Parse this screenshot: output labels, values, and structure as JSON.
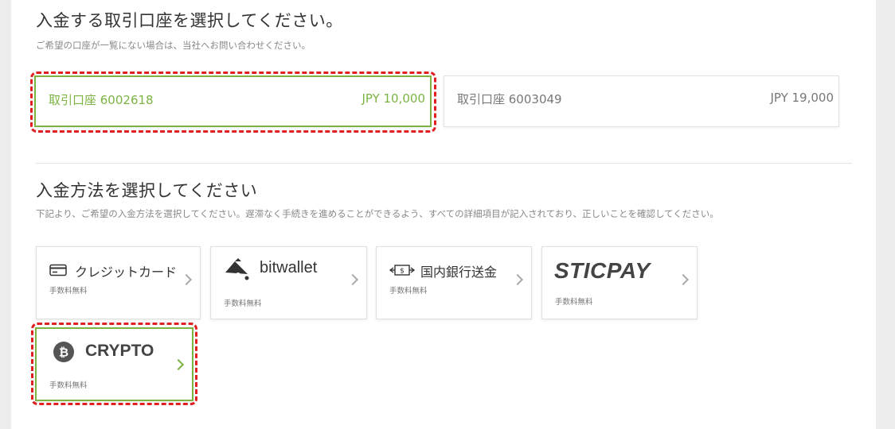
{
  "account_section": {
    "title": "入金する取引口座を選択してください。",
    "subtitle": "ご希望の口座が一覧にない場合は、当社へお問い合わせください。",
    "accounts": [
      {
        "name": "取引口座 6002618",
        "balance": "JPY 10,000",
        "selected": true
      },
      {
        "name": "取引口座 6003049",
        "balance": "JPY 19,000",
        "selected": false
      }
    ]
  },
  "method_section": {
    "title": "入金方法を選択してください",
    "subtitle": "下記より、ご希望の入金方法を選択してください。遅滞なく手続きを進めることができるよう、すべての詳細項目が記入されており、正しいことを確認してください。",
    "methods": [
      {
        "label": "クレジットカード",
        "icon": "credit-card-icon",
        "fee": "手数料無料"
      },
      {
        "label": "bitwallet",
        "icon": "bitwallet-logo-icon",
        "fee": "手数料無料"
      },
      {
        "label": "国内銀行送金",
        "icon": "bank-transfer-icon",
        "fee": "手数料無料"
      },
      {
        "label": "STICPAY",
        "icon": "sticpay-logo",
        "fee": "手数料無料"
      },
      {
        "label": "CRYPTO",
        "icon": "bitcoin-icon",
        "fee": "手数料無料",
        "selected": true
      }
    ]
  },
  "colors": {
    "accent": "#7cb342",
    "highlight": "#e02020"
  }
}
